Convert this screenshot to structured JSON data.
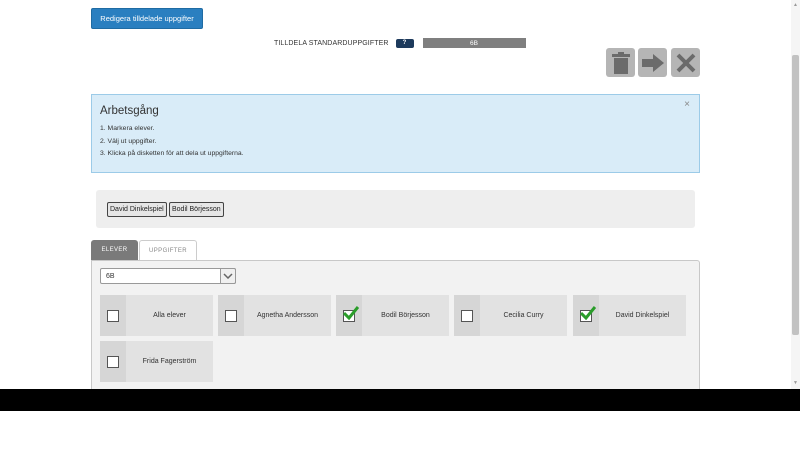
{
  "toolbar": {
    "edit_button_label": "Redigera tilldelade uppgifter",
    "assign_label": "TILLDELA STANDARDUPPGIFTER",
    "help_badge": "?",
    "class_value": "6B",
    "delete_icon": "trash-icon",
    "next_icon": "arrow-right-icon",
    "close_icon": "close-icon"
  },
  "workflow": {
    "title": "Arbetsgång",
    "close": "×",
    "steps": [
      "1.  Markera elever.",
      "2.  Välj ut uppgifter.",
      "3.  Klicka på disketten för att dela ut uppgifterna."
    ]
  },
  "selected_students": [
    "David Dinkelspiel",
    "Bodil Börjesson"
  ],
  "tabs": [
    {
      "label": "ELEVER",
      "active": true
    },
    {
      "label": "UPPGIFTER",
      "active": false
    }
  ],
  "class_select": {
    "value": "6B"
  },
  "students": [
    {
      "name": "Alla elever",
      "checked": false
    },
    {
      "name": "Agnetha Andersson",
      "checked": false
    },
    {
      "name": "Bodil Börjesson",
      "checked": true
    },
    {
      "name": "Cecilia Curry",
      "checked": false
    },
    {
      "name": "David Dinkelspiel",
      "checked": true
    },
    {
      "name": "Frida Fagerström",
      "checked": false
    }
  ],
  "colors": {
    "primary": "#2a7fc0",
    "info_background": "#d9ecf8",
    "check_green": "#2a9d2a"
  }
}
